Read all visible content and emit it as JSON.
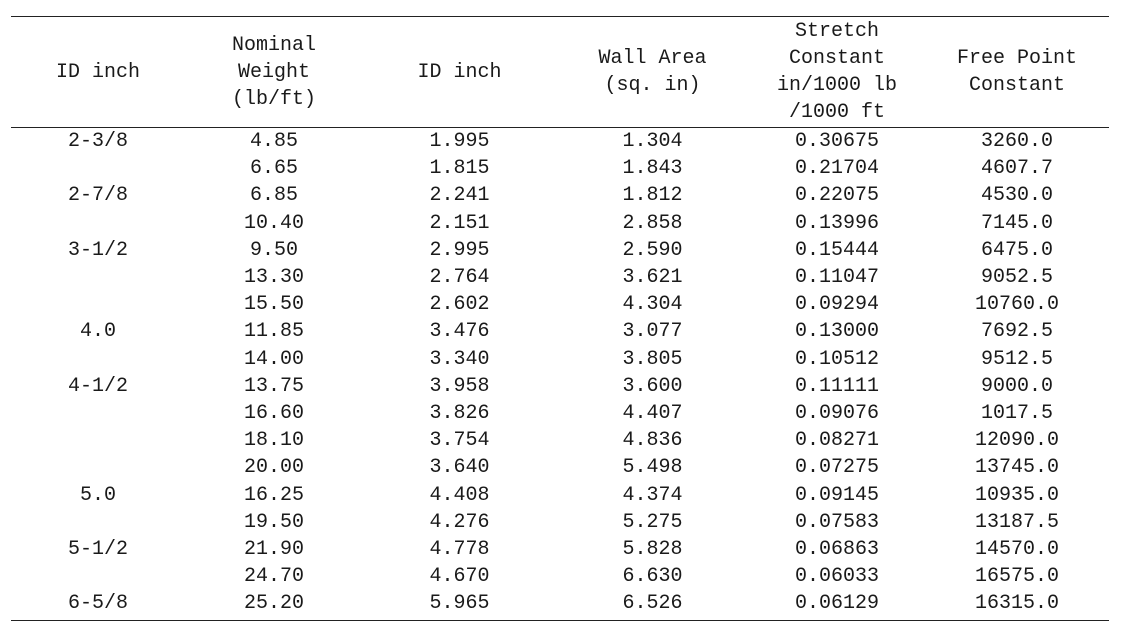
{
  "table": {
    "headers": [
      [
        "ID inch"
      ],
      [
        "Nominal",
        "Weight",
        "(lb/ft)"
      ],
      [
        "ID inch"
      ],
      [
        "Wall Area",
        "(sq. in)"
      ],
      [
        "Stretch",
        "Constant",
        "in/1000 lb",
        "/1000 ft"
      ],
      [
        "Free Point",
        "Constant"
      ]
    ],
    "rows": [
      [
        "2-3/8",
        "4.85",
        "1.995",
        "1.304",
        "0.30675",
        "3260.0"
      ],
      [
        "",
        "6.65",
        "1.815",
        "1.843",
        "0.21704",
        "4607.7"
      ],
      [
        "2-7/8",
        "6.85",
        "2.241",
        "1.812",
        "0.22075",
        "4530.0"
      ],
      [
        "",
        "10.40",
        "2.151",
        "2.858",
        "0.13996",
        "7145.0"
      ],
      [
        "3-1/2",
        "9.50",
        "2.995",
        "2.590",
        "0.15444",
        "6475.0"
      ],
      [
        "",
        "13.30",
        "2.764",
        "3.621",
        "0.11047",
        "9052.5"
      ],
      [
        "",
        "15.50",
        "2.602",
        "4.304",
        "0.09294",
        "10760.0"
      ],
      [
        "4.0",
        "11.85",
        "3.476",
        "3.077",
        "0.13000",
        "7692.5"
      ],
      [
        "",
        "14.00",
        "3.340",
        "3.805",
        "0.10512",
        "9512.5"
      ],
      [
        "4-1/2",
        "13.75",
        "3.958",
        "3.600",
        "0.11111",
        "9000.0"
      ],
      [
        "",
        "16.60",
        "3.826",
        "4.407",
        "0.09076",
        "1017.5"
      ],
      [
        "",
        "18.10",
        "3.754",
        "4.836",
        "0.08271",
        "12090.0"
      ],
      [
        "",
        "20.00",
        "3.640",
        "5.498",
        "0.07275",
        "13745.0"
      ],
      [
        "5.0",
        "16.25",
        "4.408",
        "4.374",
        "0.09145",
        "10935.0"
      ],
      [
        "",
        "19.50",
        "4.276",
        "5.275",
        "0.07583",
        "13187.5"
      ],
      [
        "5-1/2",
        "21.90",
        "4.778",
        "5.828",
        "0.06863",
        "14570.0"
      ],
      [
        "",
        "24.70",
        "4.670",
        "6.630",
        "0.06033",
        "16575.0"
      ],
      [
        "6-5/8",
        "25.20",
        "5.965",
        "6.526",
        "0.06129",
        "16315.0"
      ]
    ]
  }
}
